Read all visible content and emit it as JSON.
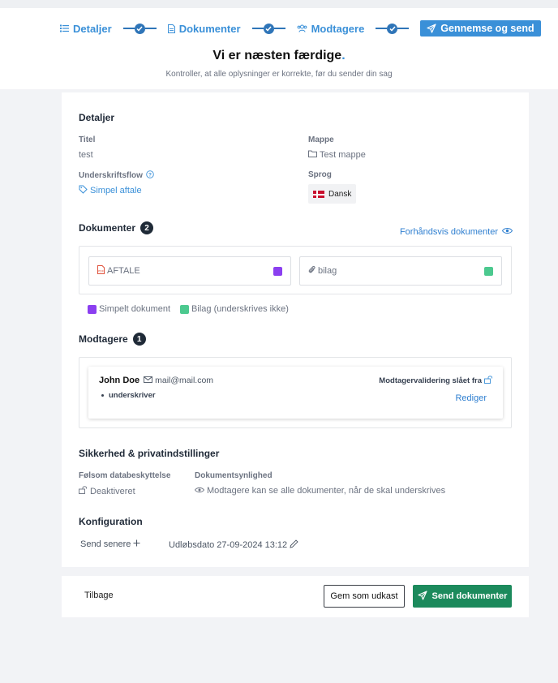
{
  "stepper": {
    "steps": [
      {
        "label": "Detaljer",
        "icon": "list-icon"
      },
      {
        "label": "Dokumenter",
        "icon": "document-icon"
      },
      {
        "label": "Modtagere",
        "icon": "people-icon"
      },
      {
        "label": "Gennemse og send",
        "icon": "send-icon",
        "active": true
      }
    ]
  },
  "header": {
    "title": "Vi er næsten færdige",
    "title_dot": ".",
    "subtitle": "Kontroller, at alle oplysninger er korrekte, før du sender din sag"
  },
  "details": {
    "heading": "Detaljer",
    "title_label": "Titel",
    "title_value": "test",
    "folder_label": "Mappe",
    "folder_value": "Test mappe",
    "flow_label": "Underskriftsflow",
    "flow_value": "Simpel aftale",
    "language_label": "Sprog",
    "language_value": "Dansk"
  },
  "documents": {
    "heading": "Dokumenter",
    "count": "2",
    "preview_label": "Forhåndsvis dokumenter",
    "items": [
      {
        "name": "AFTALE",
        "icon": "pdf-icon",
        "color": "#8b3ff0"
      },
      {
        "name": "bilag",
        "icon": "paperclip-icon",
        "color": "#4cc98f"
      }
    ],
    "legend": [
      {
        "label": "Simpelt dokument",
        "color": "#8b3ff0"
      },
      {
        "label": "Bilag (underskrives ikke)",
        "color": "#4cc98f"
      }
    ]
  },
  "recipients": {
    "heading": "Modtagere",
    "count": "1",
    "items": [
      {
        "name": "John Doe",
        "email": "mail@mail.com",
        "role": "underskriver",
        "validation": "Modtagervalidering slået fra",
        "edit_label": "Rediger"
      }
    ]
  },
  "security": {
    "heading": "Sikkerhed & privatindstillinger",
    "protection_label": "Følsom databeskyttelse",
    "protection_value": "Deaktiveret",
    "visibility_label": "Dokumentsynlighed",
    "visibility_value": "Modtagere kan se alle dokumenter, når de skal underskrives"
  },
  "configuration": {
    "heading": "Konfiguration",
    "send_later_label": "Send senere",
    "expiry_label": "Udløbsdato 27-09-2024 13:12"
  },
  "footer": {
    "back_label": "Tilbage",
    "draft_label": "Gem som udkast",
    "send_label": "Send dokumenter"
  },
  "colors": {
    "accent": "#3a90d8",
    "send_button": "#1c8a5c",
    "dark_badge": "#1f2a37"
  }
}
